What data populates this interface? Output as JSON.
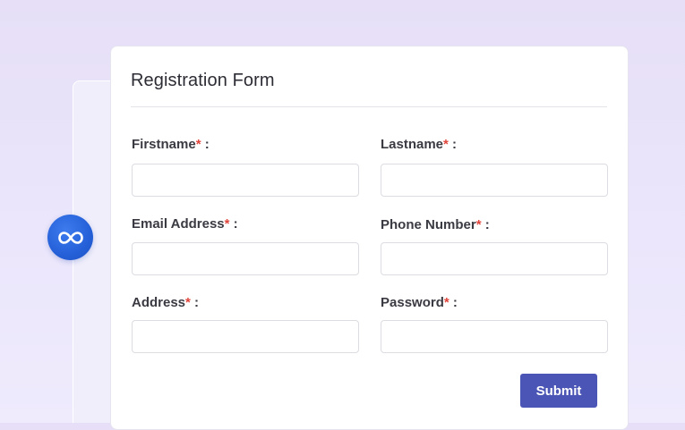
{
  "colors": {
    "accent": "#4b55b5",
    "required_marker": "#e0443a",
    "logo_blue": "#2560d8"
  },
  "logo": {
    "icon": "infinity-icon"
  },
  "form": {
    "title": "Registration Form",
    "required_marker": "*",
    "label_suffix": " :",
    "fields": [
      {
        "id": "firstname",
        "label": "Firstname",
        "value": "",
        "placeholder": ""
      },
      {
        "id": "lastname",
        "label": "Lastname",
        "value": "",
        "placeholder": ""
      },
      {
        "id": "email",
        "label": "Email Address",
        "value": "",
        "placeholder": ""
      },
      {
        "id": "phone",
        "label": "Phone Number",
        "value": "",
        "placeholder": ""
      },
      {
        "id": "address",
        "label": "Address",
        "value": "",
        "placeholder": ""
      },
      {
        "id": "password",
        "label": "Password",
        "value": "",
        "placeholder": ""
      }
    ],
    "submit_label": "Submit"
  }
}
